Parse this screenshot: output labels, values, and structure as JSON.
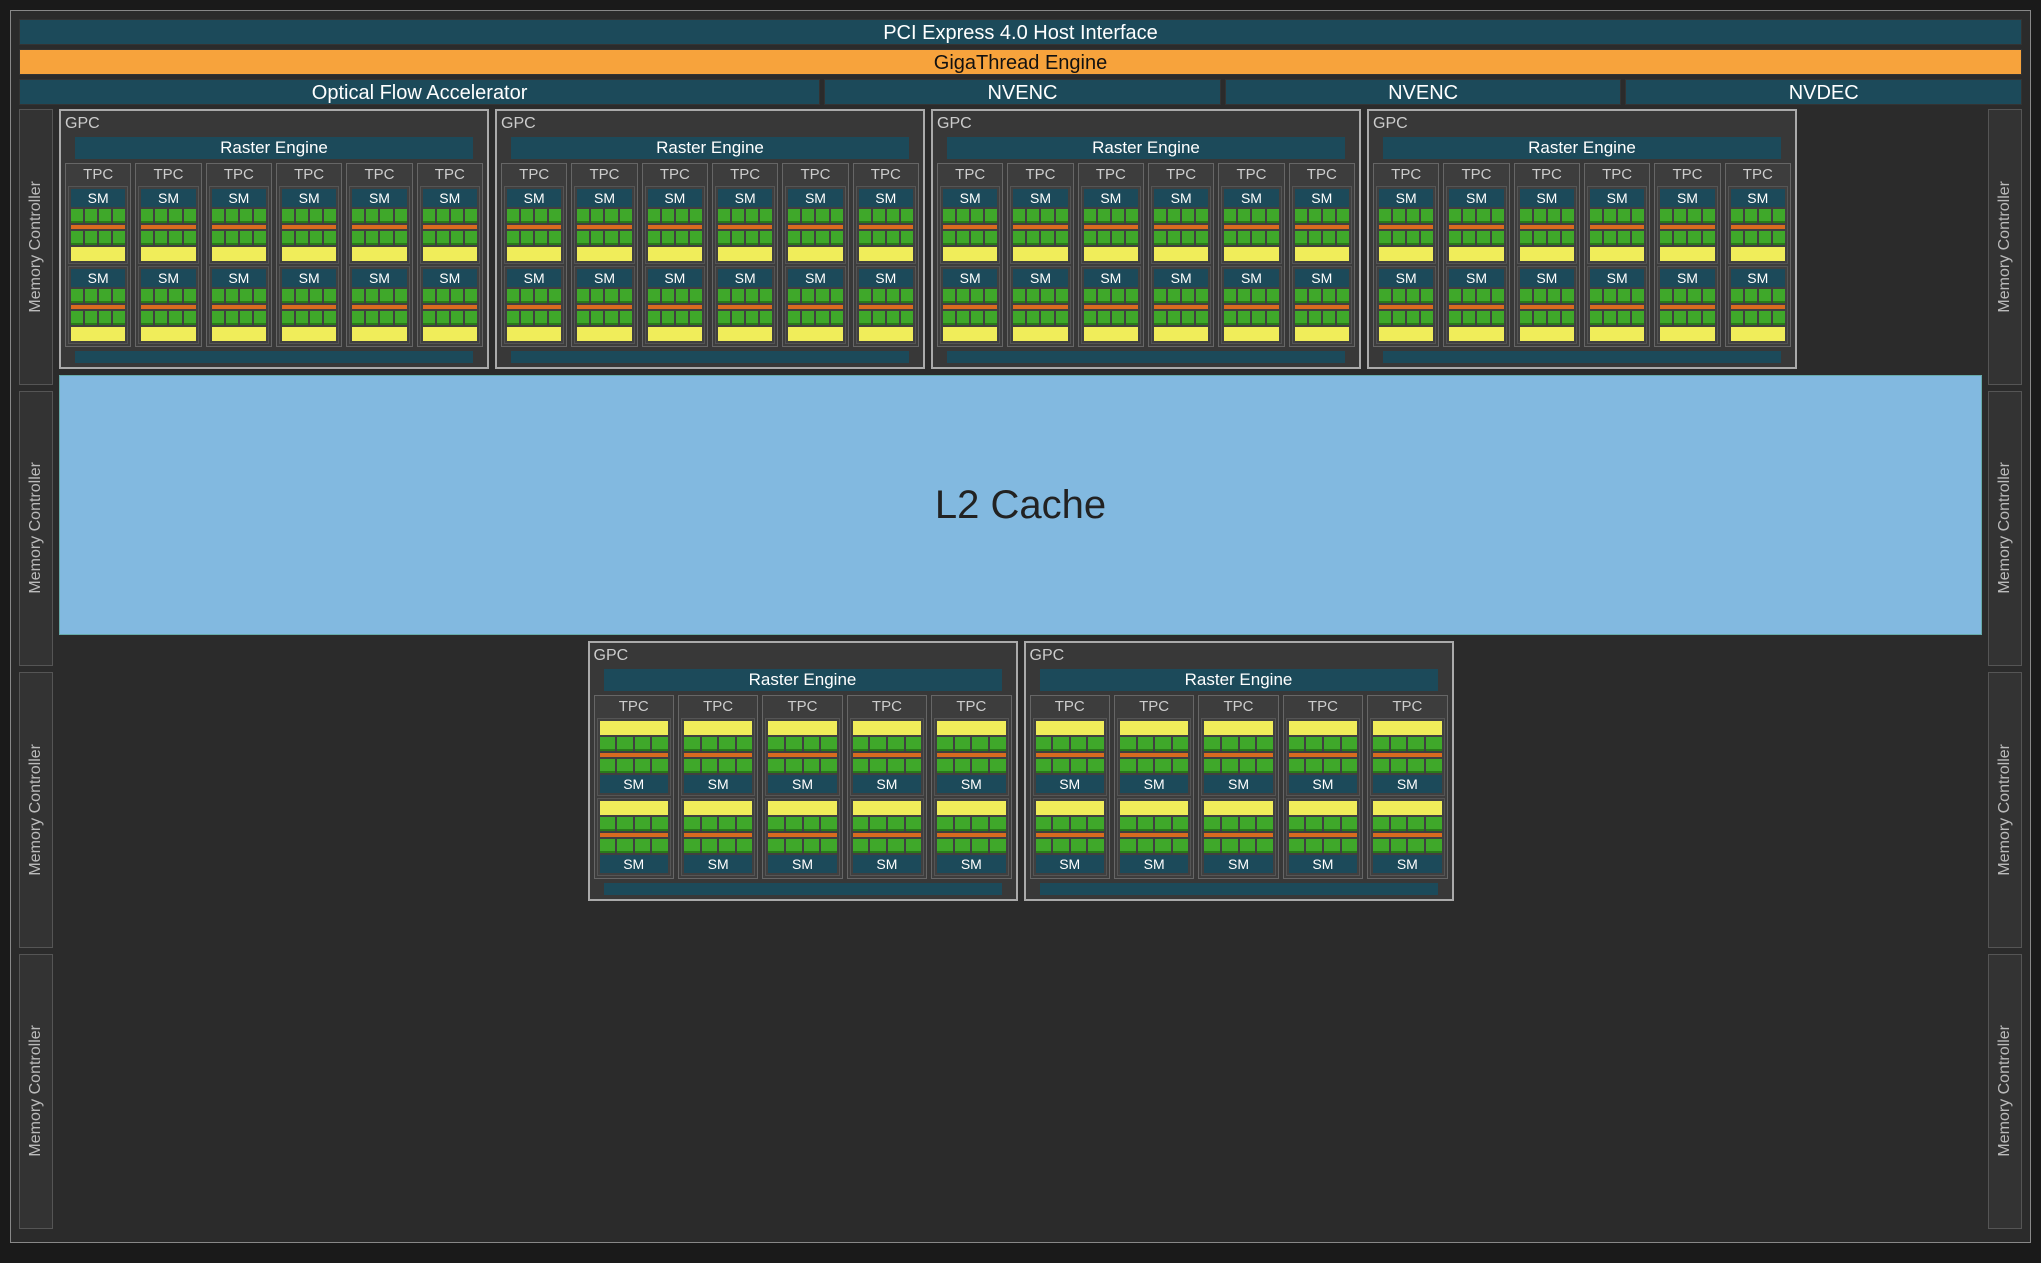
{
  "pci": "PCI Express 4.0 Host Interface",
  "giga": "GigaThread Engine",
  "ofa": "Optical Flow Accelerator",
  "nvenc": "NVENC",
  "nvdec": "NVDEC",
  "memctrl": "Memory Controller",
  "l2": "L2 Cache",
  "gpc": "GPC",
  "raster": "Raster Engine",
  "tpc": "TPC",
  "sm": "SM",
  "layout": {
    "top_engines": [
      "Optical Flow Accelerator",
      "NVENC",
      "NVENC",
      "NVDEC"
    ],
    "memory_controllers_per_side": 4,
    "gpc_top_row": 4,
    "gpc_bottom_row": 2,
    "tpc_per_top_gpc": 6,
    "tpc_per_bottom_gpc": 5,
    "sm_per_tpc": 2
  }
}
